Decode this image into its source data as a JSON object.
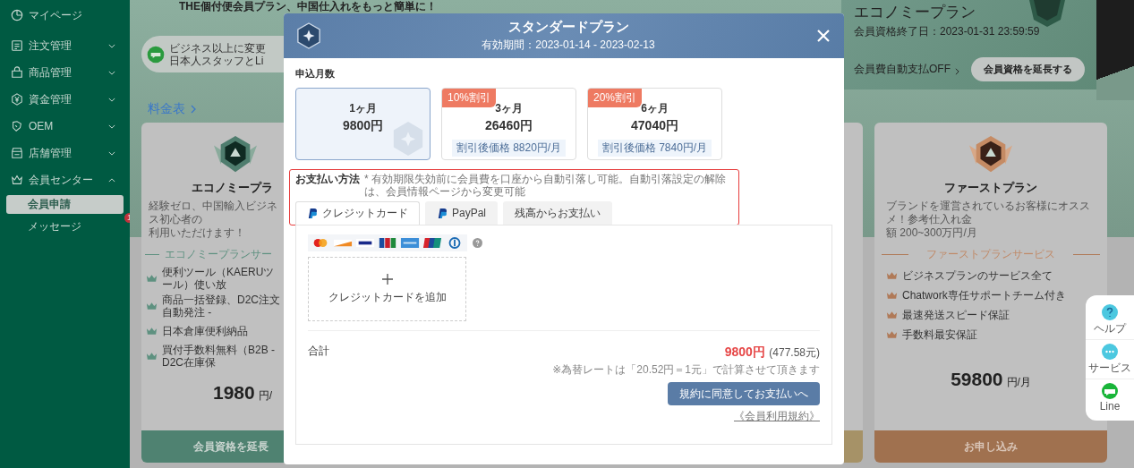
{
  "sidebar": {
    "items": [
      {
        "label": "マイページ"
      },
      {
        "label": "注文管理",
        "expanded": false
      },
      {
        "label": "商品管理",
        "expanded": false
      },
      {
        "label": "資金管理",
        "expanded": false
      },
      {
        "label": "OEM",
        "expanded": false
      },
      {
        "label": "店舗管理",
        "expanded": false
      },
      {
        "label": "会員センター",
        "expanded": true,
        "children": [
          {
            "label": "会員申請",
            "selected": true
          },
          {
            "label": "メッセージ",
            "selected": false,
            "badge": "1"
          }
        ]
      }
    ]
  },
  "banner": {
    "title": "THE個付便会員プラン、中国仕入れをもっと簡単に！",
    "line_notice": [
      "ビジネス以上に変更",
      "日本人スタッフとLi"
    ]
  },
  "pricing_link": "料金表",
  "current_plan": {
    "name": "エコノミープラン",
    "expiry": "会員資格終了日：2023-01-31 23:59:59",
    "autopay": "会員費自動支払OFF",
    "extend_button": "会員資格を延長する"
  },
  "plans": [
    {
      "kind": "economy",
      "name": "エコノミープラ",
      "description": [
        "経験ゼロ、中国輸入ビジネス初心者の",
        "利用いただけます！"
      ],
      "services_title": "エコノミープランサー",
      "services": [
        "便利ツール（KAERUツール）使い放",
        "商品一括登録、D2C注文自動発注 -",
        "日本倉庫便利納品",
        "買付手数料無料（B2B - D2C在庫保"
      ],
      "price": "1980",
      "unit": "円/",
      "button": "会員資格を延長"
    },
    {
      "kind": "premium"
    },
    {
      "kind": "first",
      "name": "ファーストプラン",
      "description": [
        "ブランドを運営されているお客様にオススメ！参考仕入れ金",
        "額 200~300万円/月"
      ],
      "services_title": "ファーストプランサービス",
      "services": [
        "ビジネスプランのサービス全て",
        "Chatwork専任サポートチーム付き",
        "最速発送スピード保証",
        "手数料最安保証"
      ],
      "price": "59800",
      "unit": "円/月",
      "button": "お申し込み"
    }
  ],
  "float_menu": [
    {
      "kind": "help",
      "label": "ヘルプ"
    },
    {
      "kind": "service",
      "label": "サービス"
    },
    {
      "kind": "line",
      "label": "Line"
    }
  ],
  "modal": {
    "title": "スタンダードプラン",
    "validity": "有効期間：2023-01-14 - 2023-02-13",
    "months_label": "申込月数",
    "options": [
      {
        "months": "1ヶ月",
        "price": "9800円",
        "selected": true
      },
      {
        "discount": "10%割引",
        "months": "3ヶ月",
        "price": "26460円",
        "per_month": "割引後価格 8820円/月",
        "selected": false
      },
      {
        "discount": "20%割引",
        "months": "6ヶ月",
        "price": "47040円",
        "per_month": "割引後価格 7840円/月",
        "selected": false
      }
    ],
    "payment_label": "お支払い方法",
    "payment_note": "* 有効期限失効前に会員費を口座から自動引落し可能。自動引落設定の解除は、会員情報ページから変更可能",
    "payment_tabs": [
      {
        "kind": "paypal",
        "label": "クレジットカード",
        "selected": true
      },
      {
        "kind": "paypal",
        "label": "PayPal",
        "selected": false
      },
      {
        "kind": "plain",
        "label": "残高からお支払い",
        "selected": false
      }
    ],
    "add_card": "クレジットカードを追加",
    "total_label": "合計",
    "total": "9800円",
    "total_cny": "(477.58元)",
    "rate_note": "※為替レートは「20.52円＝1元」で計算させて頂きます",
    "pay_button": "規約に同意してお支払いへ",
    "terms_link": "《会員利用規約》"
  }
}
